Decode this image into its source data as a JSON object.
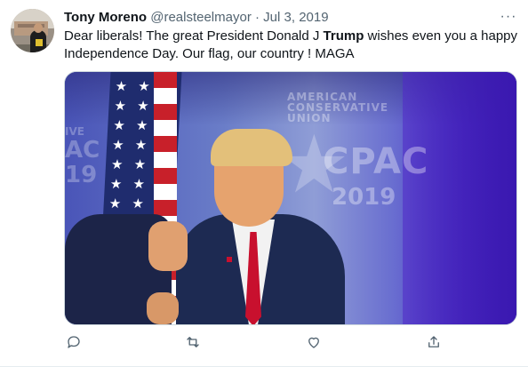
{
  "tweet": {
    "author_name": "Tony Moreno",
    "handle": "@realsteelmayor",
    "separator": "·",
    "date": "Jul 3, 2019",
    "more_label": "···",
    "text_before": "Dear liberals! The great President Donald J ",
    "text_bold": "Trump",
    "text_after": " wishes even you a happy Independence Day. Our flag, our country ! MAGA"
  },
  "media": {
    "logo_text": "CPAC",
    "logo_sub": "AMERICAN CONSERVATIVE UNION",
    "logo_year": "2019",
    "left_text_1": "IVE",
    "left_text_2": "AC",
    "left_text_3": "19"
  },
  "actions": {
    "reply_icon": "reply-icon",
    "retweet_icon": "retweet-icon",
    "like_icon": "heart-icon",
    "share_icon": "share-icon",
    "icon_color": "#536471"
  }
}
